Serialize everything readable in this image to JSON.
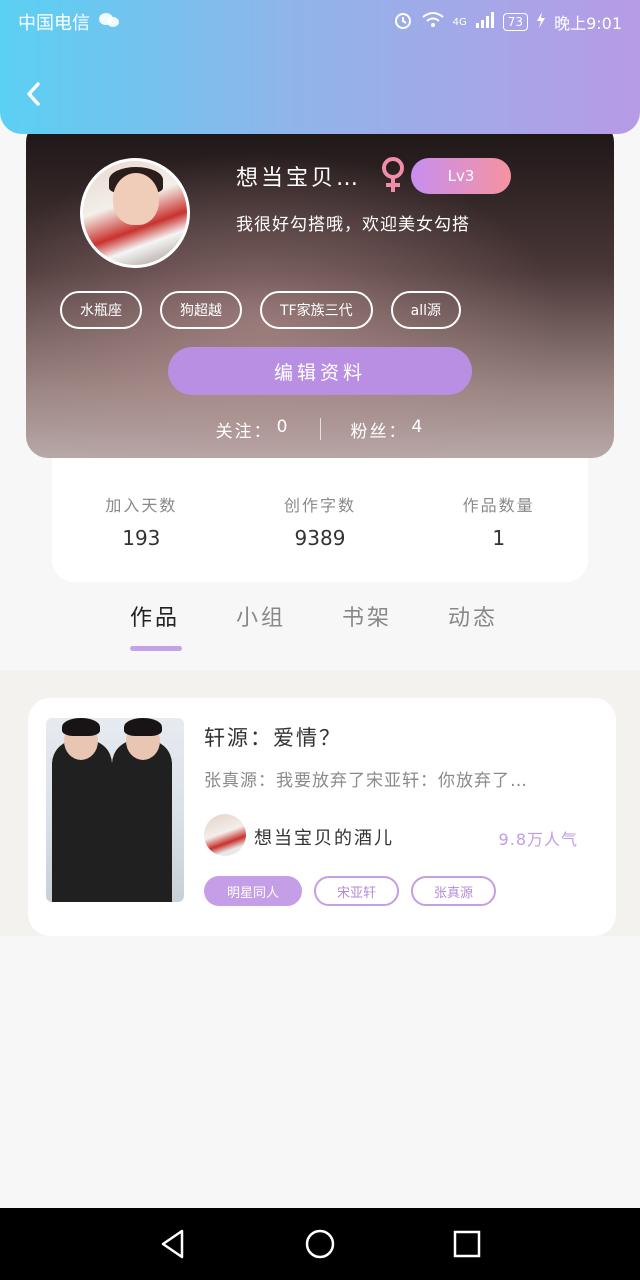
{
  "status_bar": {
    "carrier": "中国电信",
    "network": "4G",
    "battery": "73",
    "time": "晚上9:01"
  },
  "profile": {
    "name": "想当宝贝…",
    "level": "Lv3",
    "bio": "我很好勾搭哦，欢迎美女勾搭",
    "tags": [
      "水瓶座",
      "狗超越",
      "TF家族三代",
      "all源"
    ],
    "edit_button": "编辑资料",
    "follow_label": "关注：",
    "follow_count": "0",
    "fans_label": "粉丝：",
    "fans_count": "4"
  },
  "stats": [
    {
      "label": "加入天数",
      "value": "193"
    },
    {
      "label": "创作字数",
      "value": "9389"
    },
    {
      "label": "作品数量",
      "value": "1"
    }
  ],
  "tabs": [
    "作品",
    "小组",
    "书架",
    "动态"
  ],
  "work": {
    "title": "轩源：爱情？",
    "excerpt": "张真源：我要放弃了宋亚轩：你放弃了…",
    "author": "想当宝贝的酒儿",
    "popularity": "9.8万人气",
    "tags": [
      "明星同人",
      "宋亚轩",
      "张真源"
    ]
  },
  "colors": {
    "accent": "#b88fe3",
    "header_start": "#5ad0f3",
    "header_end": "#b79be6",
    "gender_icon": "#f08da8"
  }
}
